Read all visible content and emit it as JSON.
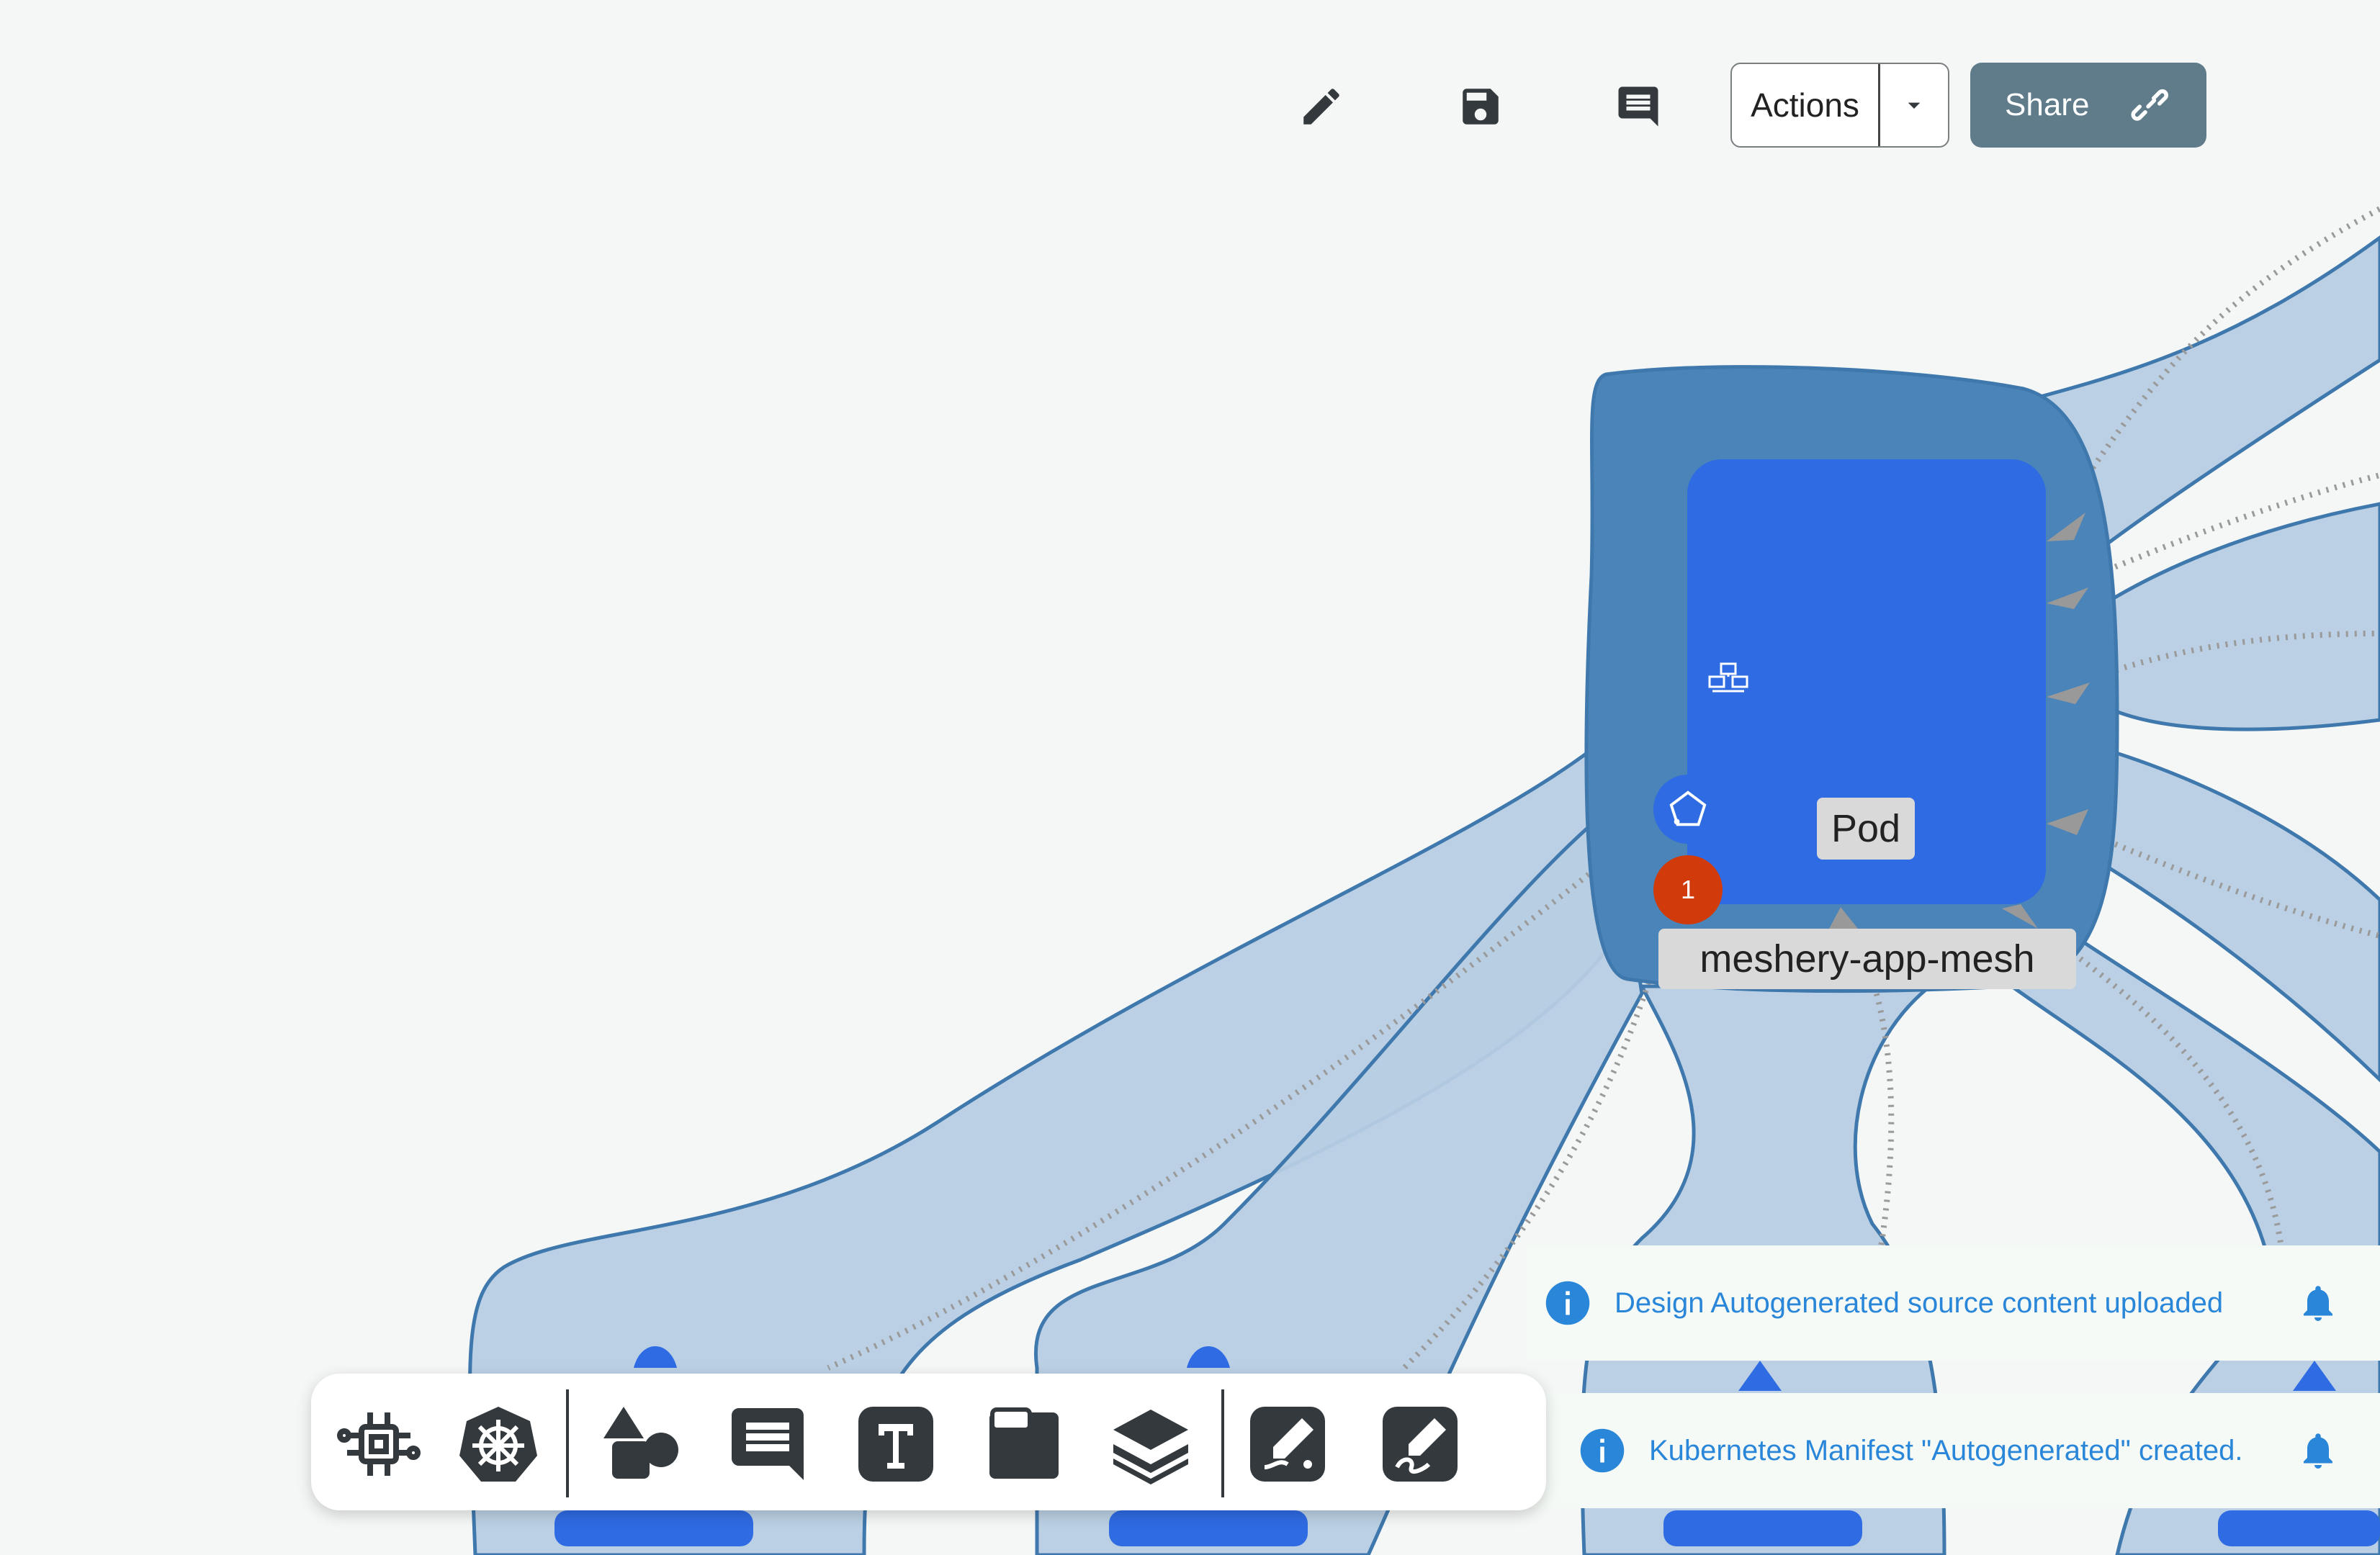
{
  "toolbar": {
    "edit_icon": "pencil-icon",
    "save_icon": "floppy-disk-icon",
    "comment_icon": "comment-icon",
    "actions_label": "Actions",
    "share_label": "Share",
    "share_icon": "link-icon"
  },
  "canvas": {
    "node_type_label": "Pod",
    "node_name": "meshery-app-mesh",
    "error_count": "1",
    "node_color": "#2f6be3",
    "compound_color": "#4a84b8",
    "edge_color": "#9ab9d7"
  },
  "dock": {
    "items": [
      {
        "icon": "components-icon"
      },
      {
        "icon": "kubernetes-icon"
      },
      {
        "icon": "shapes-icon"
      },
      {
        "icon": "comment-icon"
      },
      {
        "icon": "text-icon"
      },
      {
        "icon": "section-icon"
      },
      {
        "icon": "layers-icon"
      },
      {
        "icon": "pen-draw-icon"
      },
      {
        "icon": "freehand-draw-icon"
      }
    ]
  },
  "notifications": [
    {
      "text": "Design Autogenerated source content uploaded",
      "icon": "info-icon"
    },
    {
      "text": "Kubernetes Manifest \"Autogenerated\" created.",
      "icon": "info-icon"
    }
  ],
  "colors": {
    "accent": "#607b8a",
    "info": "#2a86d8",
    "error": "#d13a0a"
  }
}
